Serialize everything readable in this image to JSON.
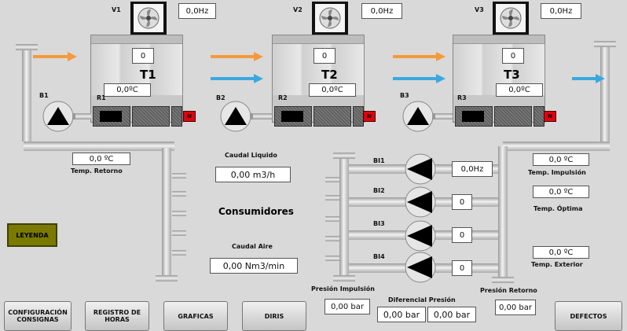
{
  "units": [
    {
      "name": "T1",
      "fan": "V1",
      "fan_hz": "0,0Hz",
      "count": "0",
      "temp": "0,0ºC",
      "pump": "B1",
      "grille": "R1",
      "status": "N"
    },
    {
      "name": "T2",
      "fan": "V2",
      "fan_hz": "0,0Hz",
      "count": "0",
      "temp": "0,0ºC",
      "pump": "B2",
      "grille": "R2",
      "status": "N"
    },
    {
      "name": "T3",
      "fan": "V3",
      "fan_hz": "0,0Hz",
      "count": "0",
      "temp": "0,0ºC",
      "pump": "B3",
      "grille": "R3",
      "status": "N"
    }
  ],
  "temp_retorno": {
    "label": "Temp. Retorno",
    "value": "0,0 ºC"
  },
  "caudal_liquido": {
    "label": "Caudal Liquido",
    "value": "0,00 m3/h"
  },
  "consumidores": "Consumidores",
  "caudal_aire": {
    "label": "Caudal Aire",
    "value": "0,00 Nm3/min"
  },
  "bombas_impulsion": [
    {
      "name": "BI1",
      "value": "0,0Hz"
    },
    {
      "name": "BI2",
      "value": "0"
    },
    {
      "name": "BI3",
      "value": "0"
    },
    {
      "name": "BI4",
      "value": "0"
    }
  ],
  "temps_right": [
    {
      "label": "Temp. Impulsión",
      "value": "0,0 ºC"
    },
    {
      "label": "Temp. Óptima",
      "value": "0,0 ºC"
    },
    {
      "label": "Temp. Exterior",
      "value": "0,0 ºC"
    }
  ],
  "presion_impulsion": {
    "label": "Presión Impulsión",
    "value": "0,00 bar"
  },
  "diferencial_presion": {
    "label": "Diferencial Presión",
    "value1": "0,00 bar",
    "value2": "0,00 bar"
  },
  "presion_retorno": {
    "label": "Presión Retorno",
    "value": "0,00 bar"
  },
  "leyenda": "LEYENDA",
  "buttons": {
    "configuracion": "CONFIGURACIÓN CONSIGNAS",
    "registro": "REGISTRO DE HORAS",
    "graficas": "GRAFICAS",
    "diris": "DIRIS",
    "defectos": "DEFECTOS"
  },
  "colors": {
    "background": "#d9d9d9",
    "flow_hot": "#f59a3a",
    "flow_cold": "#3aa8e0",
    "alarm": "#e00010",
    "leyenda": "#7a7a00"
  }
}
